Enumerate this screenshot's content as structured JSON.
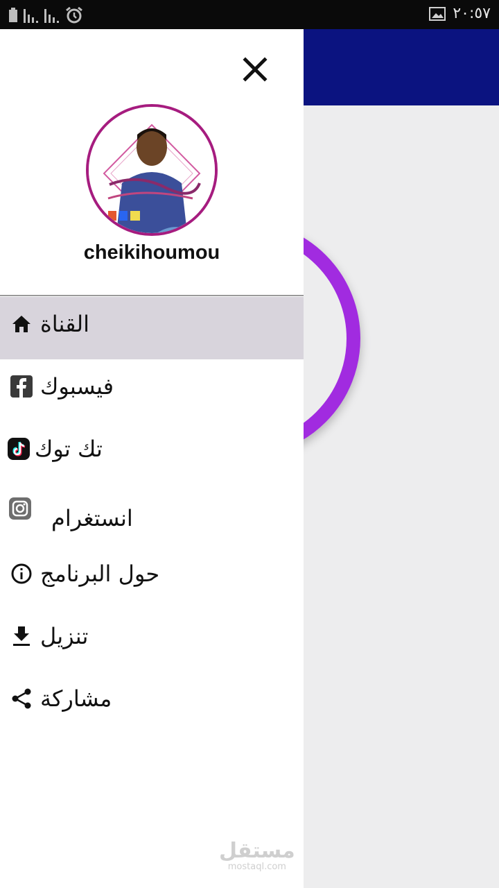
{
  "status_bar": {
    "time": "٢٠:٥٧"
  },
  "drawer": {
    "username": "cheikihoumou",
    "menu": [
      {
        "label": "القناة",
        "icon": "home-icon",
        "selected": true
      },
      {
        "label": "فيسبوك",
        "icon": "facebook-icon"
      },
      {
        "label": "تك توك",
        "icon": "tiktok-icon"
      },
      {
        "label": "انستغرام",
        "icon": "instagram-icon"
      },
      {
        "label": "حول البرنامج",
        "icon": "info-icon"
      },
      {
        "label": "تنزيل",
        "icon": "download-icon"
      },
      {
        "label": "مشاركة",
        "icon": "share-icon"
      }
    ]
  },
  "watermark": {
    "arabic": "مستقل",
    "latin": "mostaql.com"
  },
  "colors": {
    "app_bar": "#0b1380",
    "ring": "#a12be0",
    "selected_item": "#d8d4dc",
    "avatar_border": "#a61c7f"
  }
}
